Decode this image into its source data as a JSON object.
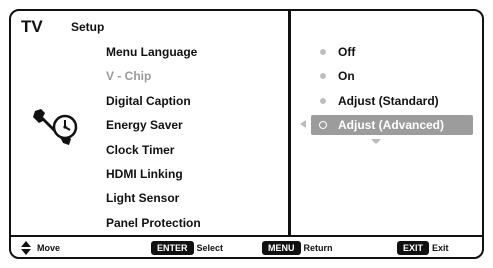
{
  "header": {
    "device": "TV",
    "title": "Setup"
  },
  "menu": {
    "items": [
      {
        "label": "Menu Language"
      },
      {
        "label": "V - Chip",
        "disabled": true
      },
      {
        "label": "Digital Caption"
      },
      {
        "label": "Energy Saver"
      },
      {
        "label": "Clock Timer"
      },
      {
        "label": "HDMI Linking"
      },
      {
        "label": "Light Sensor"
      },
      {
        "label": "Panel Protection"
      }
    ]
  },
  "options": {
    "items": [
      {
        "label": "Off"
      },
      {
        "label": "On"
      },
      {
        "label": "Adjust (Standard)"
      },
      {
        "label": "Adjust (Advanced)",
        "selected": true
      }
    ],
    "highlight_color": "#9c9c9c"
  },
  "footer": {
    "move_label": "Move",
    "enter_key": "ENTER",
    "select_label": "Select",
    "menu_key": "MENU",
    "return_label": "Return",
    "exit_key": "EXIT",
    "exit_label": "Exit"
  },
  "icons": {
    "setup": "setup-wrench-clock-icon",
    "move": "up-down-arrows-icon"
  }
}
